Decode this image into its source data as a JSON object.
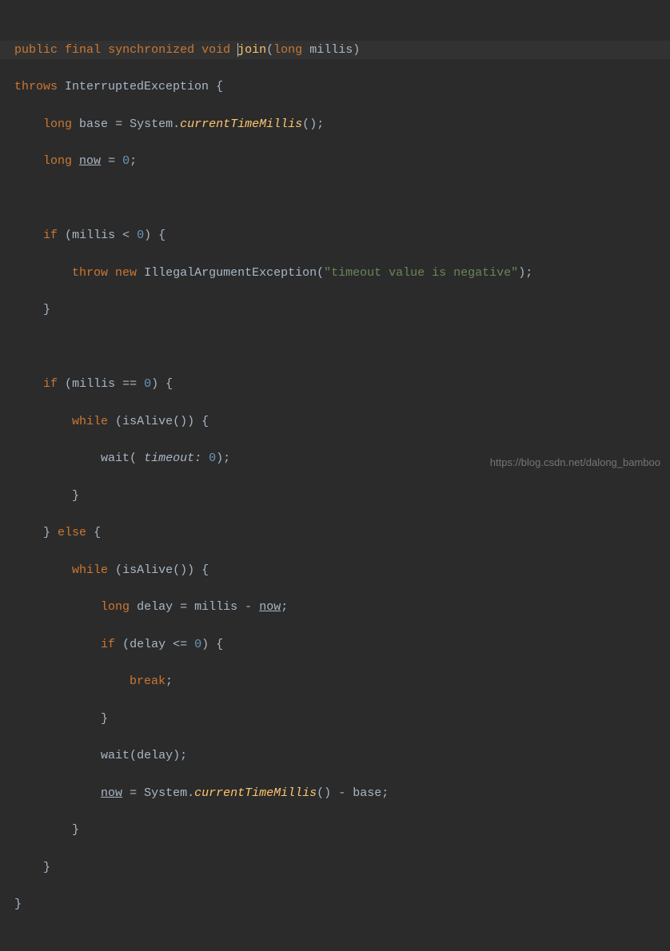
{
  "code": {
    "kw_public": "public",
    "kw_final": "final",
    "kw_synchronized": "synchronized",
    "kw_void": "void",
    "method_join": "join",
    "param_type_long": "long",
    "param_millis": "millis",
    "kw_throws": "throws",
    "ex_type": "InterruptedException",
    "brace_open": "{",
    "brace_close": "}",
    "kw_long": "long",
    "var_base": "base",
    "eq": "=",
    "cls_System": "System",
    "dot": ".",
    "m_currentTimeMillis": "currentTimeMillis",
    "paren_open": "(",
    "paren_close": ")",
    "semi": ";",
    "var_now": "now",
    "zero": "0",
    "kw_if": "if",
    "lt": "<",
    "kw_throw": "throw",
    "kw_new": "new",
    "ex_IllegalArg": "IllegalArgumentException",
    "str_timeout_neg": "\"timeout value is negative\"",
    "eqeq": "==",
    "kw_while": "while",
    "m_isAlive": "isAlive",
    "m_wait": "wait",
    "hint_timeout": "timeout:",
    "kw_else": "else",
    "var_delay": "delay",
    "minus": "-",
    "le": "<=",
    "kw_break": "break"
  },
  "watermark": "https://blog.csdn.net/dalong_bamboo"
}
